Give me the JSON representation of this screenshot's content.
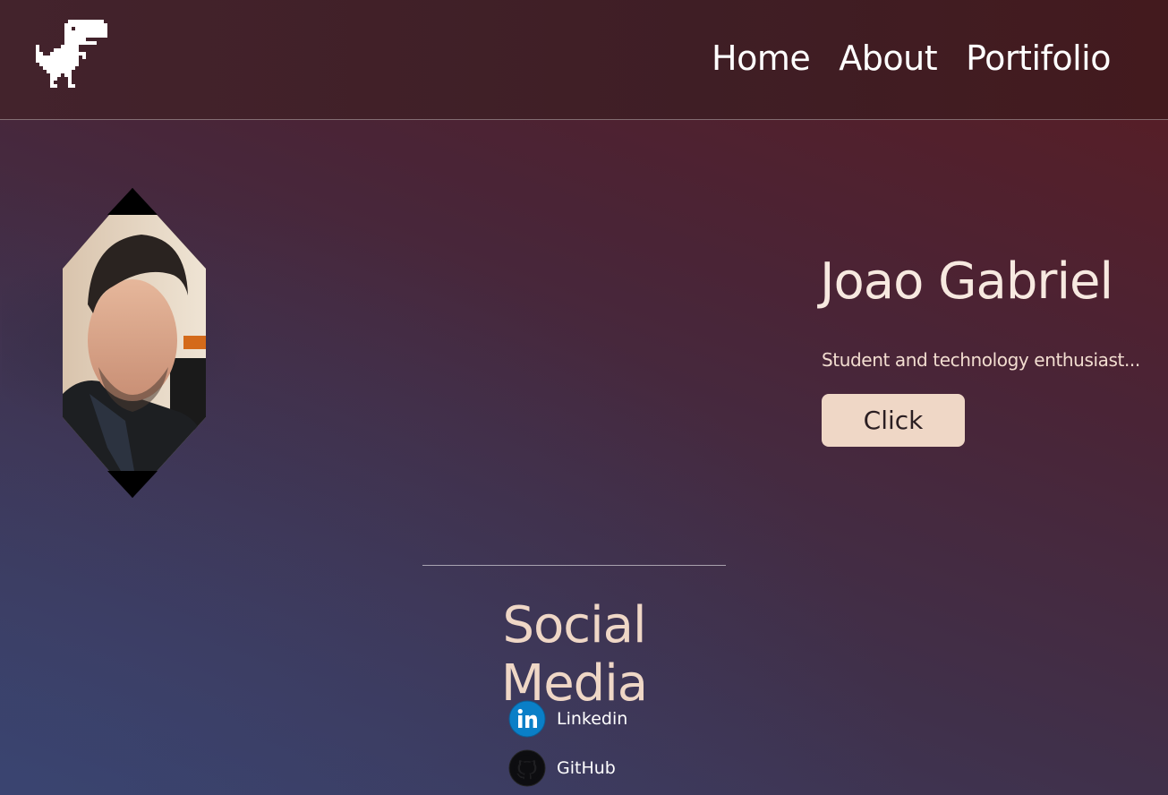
{
  "nav": {
    "items": [
      "Home",
      "About",
      "Portifolio"
    ]
  },
  "hero": {
    "name": "Joao Gabriel",
    "tagline": "Student and technology enthusiast...",
    "button_label": "Click"
  },
  "social": {
    "title": "Social Media",
    "links": [
      {
        "label": "Linkedin",
        "icon": "linkedin-icon"
      },
      {
        "label": "GitHub",
        "icon": "github-icon"
      }
    ]
  },
  "colors": {
    "accent": "#efd7c6",
    "linkedin": "#0a66c2"
  }
}
